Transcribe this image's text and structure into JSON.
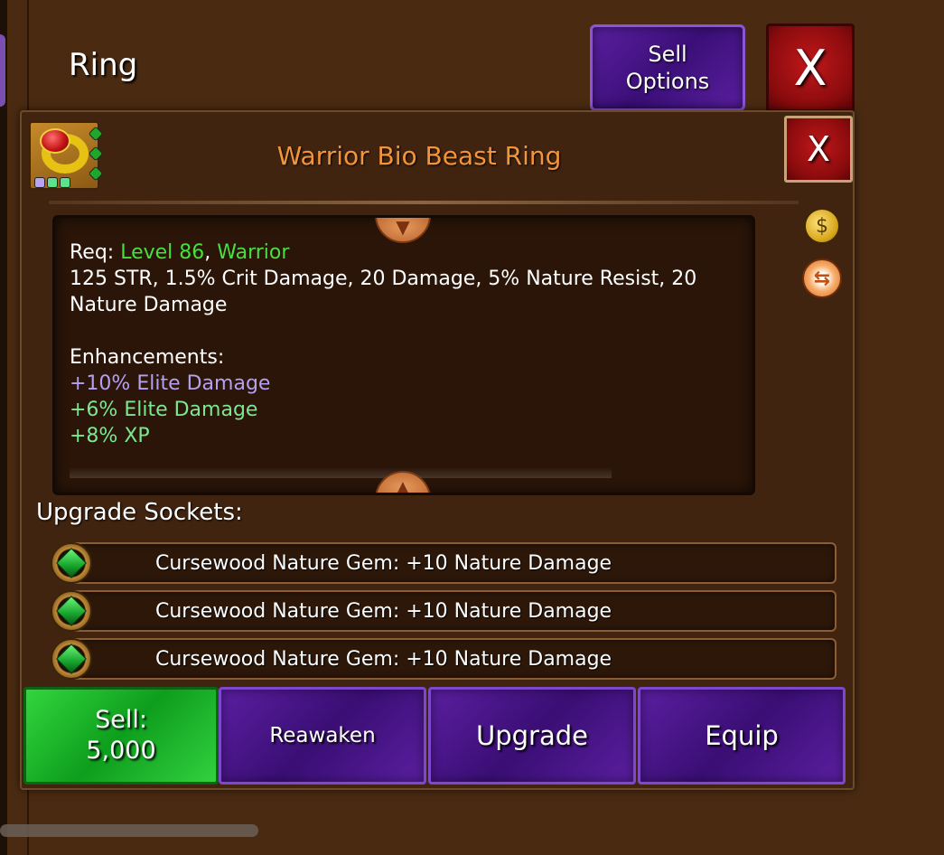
{
  "header": {
    "title": "Ring",
    "sell_options_label": "Sell Options",
    "close_label": "X"
  },
  "item": {
    "name": "Warrior Bio Beast Ring",
    "close_label": "X",
    "description": {
      "req_prefix": "Req:",
      "req_level": "Level 86",
      "req_separator": ",",
      "req_class": "Warrior",
      "stats": "125 STR, 1.5% Crit Damage, 20 Damage, 5% Nature Resist, 20 Nature Damage",
      "enhancements_label": "Enhancements:",
      "enhancements": [
        {
          "text": "+10% Elite Damage",
          "color": "#b5a0f0"
        },
        {
          "text": "+6% Elite Damage",
          "color": "#7be88f"
        },
        {
          "text": "+8% XP",
          "color": "#7be88f"
        }
      ]
    },
    "colors": {
      "title": "#f2953a",
      "requirement": "#46e041"
    }
  },
  "sockets": {
    "label": "Upgrade Sockets:",
    "items": [
      {
        "text": "Cursewood Nature Gem: +10 Nature Damage",
        "icon": "green-gem-icon"
      },
      {
        "text": "Cursewood Nature Gem: +10 Nature Damage",
        "icon": "green-gem-icon"
      },
      {
        "text": "Cursewood Nature Gem: +10 Nature Damage",
        "icon": "green-gem-icon"
      }
    ]
  },
  "actions": {
    "sell_label": "Sell:",
    "sell_price": "5,000",
    "reawaken_label": "Reawaken",
    "upgrade_label": "Upgrade",
    "equip_label": "Equip"
  },
  "icons": {
    "money": "money-bag-icon",
    "swap": "swap-icon",
    "scroll_up": "chevron-down-icon",
    "scroll_down": "chevron-up-icon"
  }
}
